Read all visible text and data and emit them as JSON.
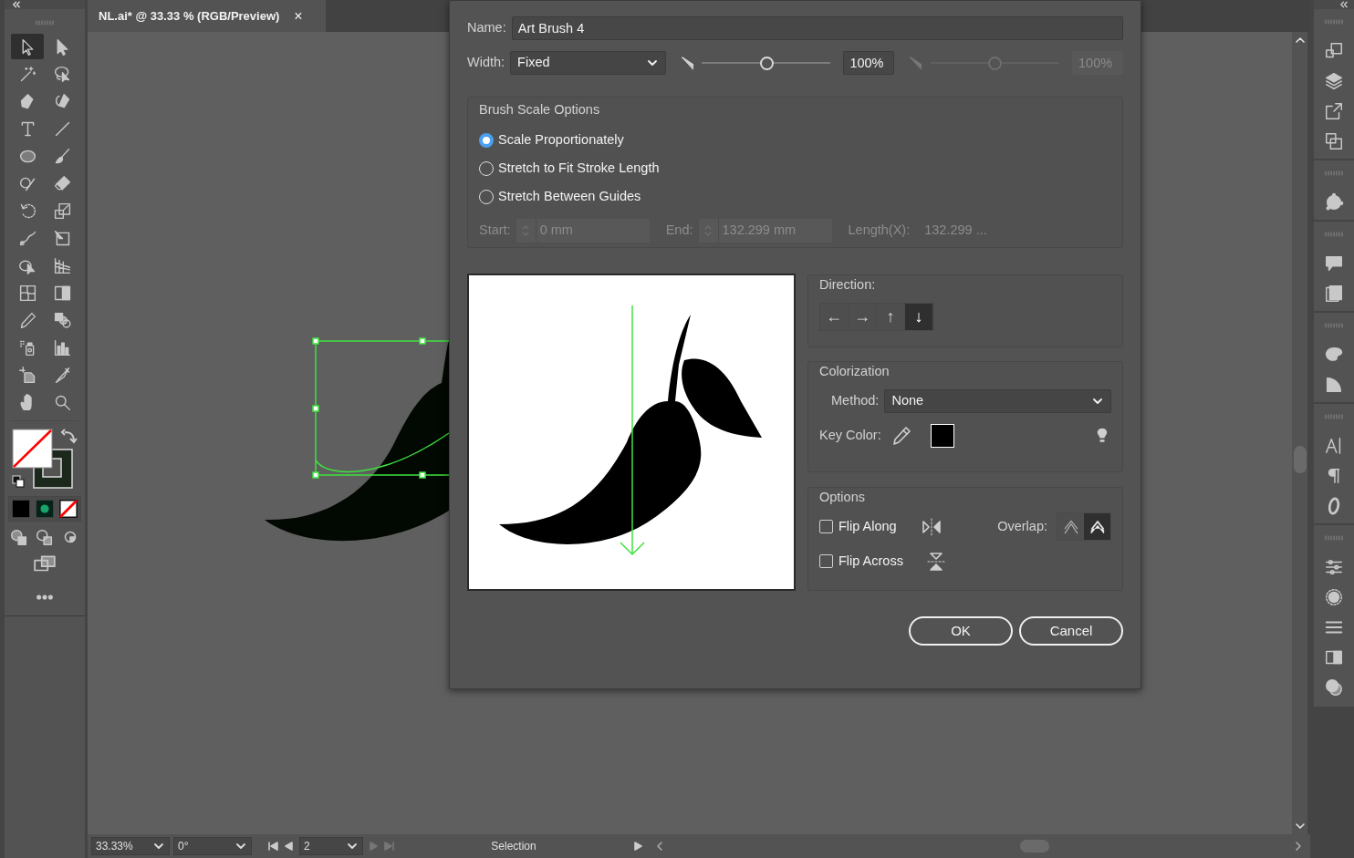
{
  "document_tab": {
    "title": "NL.ai* @ 33.33 % (RGB/Preview)",
    "close": "×"
  },
  "tools": [
    {
      "selected": true
    },
    {
      "selected": false
    },
    {
      "selected": false
    },
    {
      "selected": false
    },
    {
      "selected": false
    },
    {
      "selected": false
    },
    {
      "selected": false
    },
    {
      "selected": false
    },
    {
      "selected": false
    },
    {
      "selected": false
    },
    {
      "selected": false
    },
    {
      "selected": false
    },
    {
      "selected": false
    },
    {
      "selected": false
    },
    {
      "selected": false
    },
    {
      "selected": false
    },
    {
      "selected": false
    },
    {
      "selected": false
    },
    {
      "selected": false
    },
    {
      "selected": false
    },
    {
      "selected": false
    },
    {
      "selected": false
    },
    {
      "selected": false
    },
    {
      "selected": false
    },
    {
      "selected": false
    },
    {
      "selected": false
    },
    {
      "selected": false
    },
    {
      "selected": false
    }
  ],
  "dialog": {
    "name": {
      "label": "Name:",
      "value": "Art Brush 4"
    },
    "width": {
      "label": "Width:",
      "value": "Fixed"
    },
    "sliders": [
      {
        "level": 0.5,
        "value": "100%",
        "disabled": false
      },
      {
        "level": 0.5,
        "value": "100%",
        "disabled": true
      }
    ],
    "scale_options": {
      "title": "Brush Scale Options",
      "options": [
        {
          "label": "Scale Proportionately",
          "selected": true
        },
        {
          "label": "Stretch to Fit Stroke Length",
          "selected": false
        },
        {
          "label": "Stretch Between Guides",
          "selected": false
        }
      ],
      "guides": [
        {
          "label": "Start:",
          "value": "0 mm",
          "disabled": true
        },
        {
          "label": "End:",
          "value": "132.299 mm",
          "disabled": true
        }
      ],
      "length": {
        "label": "Length(X):",
        "value": "132.299 ...",
        "disabled": true
      }
    },
    "direction": {
      "title": "Direction:",
      "options": [
        {
          "symbol": "←",
          "selected": false
        },
        {
          "symbol": "→",
          "selected": false
        },
        {
          "symbol": "↑",
          "selected": false
        },
        {
          "symbol": "↓",
          "selected": true
        }
      ]
    },
    "colorization": {
      "title": "Colorization",
      "method_label": "Method:",
      "method": "None",
      "key_color_label": "Key Color:"
    },
    "options": {
      "title": "Options",
      "flips": [
        {
          "label": "Flip Along",
          "checked": false
        },
        {
          "label": "Flip Across",
          "checked": false
        }
      ],
      "overlap_label": "Overlap:",
      "overlap": [
        {
          "selected": false
        },
        {
          "selected": true
        }
      ]
    },
    "buttons": [
      {
        "label": "OK"
      },
      {
        "label": "Cancel"
      }
    ]
  },
  "status_bar": {
    "zoom": "33.33%",
    "rotation": "0°",
    "artboard": "2",
    "tool_name": "Selection"
  }
}
